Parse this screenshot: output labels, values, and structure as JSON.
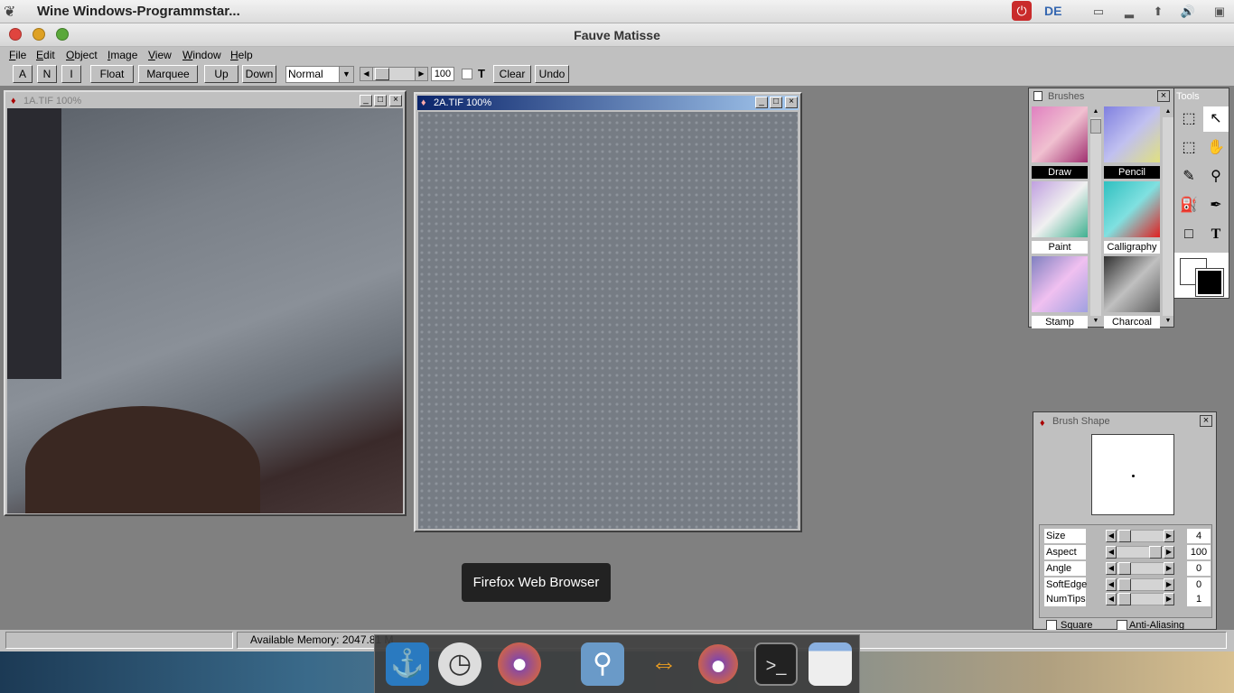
{
  "system": {
    "window_title": "Wine Windows-Programmstar...",
    "lang": "DE"
  },
  "app": {
    "title": "Fauve Matisse",
    "menu": [
      "File",
      "Edit",
      "Object",
      "Image",
      "View",
      "Window",
      "Help"
    ],
    "toolbar": {
      "btn_a": "A",
      "btn_n": "N",
      "btn_i": "I",
      "float": "Float",
      "marquee": "Marquee",
      "up": "Up",
      "down": "Down",
      "mode": "Normal",
      "opacity": "100",
      "t_label": "T",
      "clear": "Clear",
      "undo": "Undo"
    }
  },
  "windows": {
    "doc1": {
      "title": "1A.TIF 100%"
    },
    "doc2": {
      "title": "2A.TIF 100%"
    }
  },
  "brushes": {
    "title": "Brushes",
    "items": [
      "Draw",
      "Pencil",
      "Paint",
      "Calligraphy",
      "Stamp",
      "Charcoal"
    ],
    "selected": "Draw"
  },
  "tools": {
    "title": "Tools",
    "icons": [
      "transform-icon",
      "arrow-icon",
      "marquee-icon",
      "hand-icon",
      "eyedropper-icon",
      "zoom-icon",
      "fill-icon",
      "pen-icon",
      "rectangle-icon",
      "text-icon"
    ]
  },
  "brush_shape": {
    "title": "Brush Shape",
    "rows": [
      {
        "label": "Size",
        "value": "4"
      },
      {
        "label": "Aspect",
        "value": "100"
      },
      {
        "label": "Angle",
        "value": "0"
      },
      {
        "label": "SoftEdge",
        "value": "0"
      },
      {
        "label": "NumTips",
        "value": "1"
      }
    ],
    "square": "Square",
    "anti_aliasing": "Anti-Aliasing"
  },
  "status": {
    "memory": "Available Memory: 2047.81 M"
  },
  "dock": {
    "tooltip": "Firefox Web Browser",
    "items": [
      "anchor-icon",
      "clock-icon",
      "firefox-icon",
      "search-icon",
      "arrows-icon",
      "firefox-icon",
      "terminal-icon",
      "window-icon"
    ]
  }
}
